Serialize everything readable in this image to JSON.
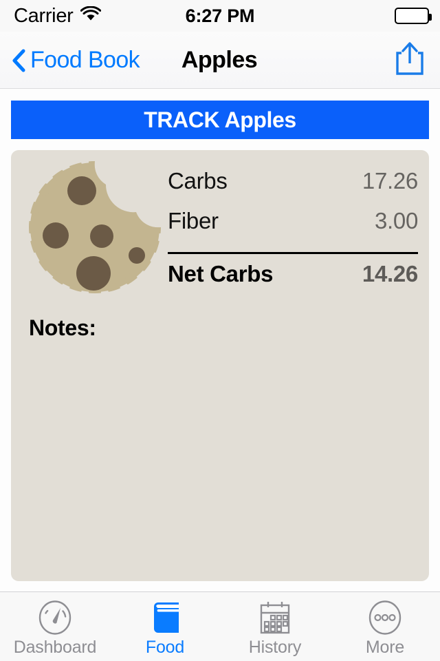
{
  "status_bar": {
    "carrier": "Carrier",
    "wifi_icon": "wifi-icon",
    "time": "6:27 PM",
    "battery_icon": "battery-full-icon"
  },
  "nav_bar": {
    "back_icon": "chevron-left-icon",
    "back_label": "Food Book",
    "title": "Apples",
    "share_icon": "share-up-icon"
  },
  "track_button": {
    "label": "TRACK Apples",
    "color": "#0a60fa"
  },
  "card": {
    "background_color": "#e2ded6",
    "food_icon": "cookie-icon",
    "nutrition": {
      "rows": [
        {
          "label": "Carbs",
          "value": "17.26"
        },
        {
          "label": "Fiber",
          "value": "3.00"
        }
      ],
      "total": {
        "label": "Net Carbs",
        "value": "14.26"
      }
    },
    "notes": {
      "label": "Notes:",
      "value": "",
      "placeholder": ""
    }
  },
  "tab_bar": {
    "active_color": "#0a7cff",
    "inactive_color": "#8e8e93",
    "tabs": [
      {
        "label": "Dashboard",
        "icon": "gauge-icon",
        "active": false
      },
      {
        "label": "Food",
        "icon": "book-icon",
        "active": true
      },
      {
        "label": "History",
        "icon": "calendar-icon",
        "active": false
      },
      {
        "label": "More",
        "icon": "ellipsis-circle-icon",
        "active": false
      }
    ]
  }
}
